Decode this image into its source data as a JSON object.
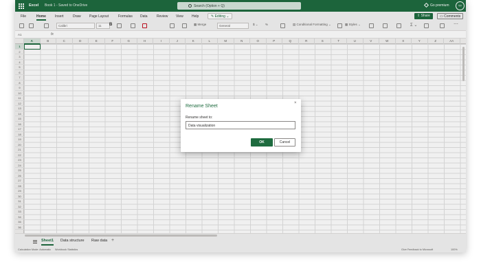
{
  "titlebar": {
    "app_name": "Excel",
    "doc_title": "Book 1 - Saved to OneDrive",
    "search_placeholder": "Search (Option + Q)",
    "premium": "Go premium",
    "avatar": "TT"
  },
  "tabs": [
    "File",
    "Home",
    "Insert",
    "Draw",
    "Page Layout",
    "Formulas",
    "Data",
    "Review",
    "View",
    "Help"
  ],
  "active_tab": "Home",
  "editing_label": "Editing",
  "share_label": "Share",
  "comments_label": "Comments",
  "ribbon": {
    "font_name": "Calibri",
    "font_size": "11",
    "bold": "B",
    "merge": "Merge",
    "number_format": "General",
    "conditional_formatting": "Conditional Formatting",
    "styles": "Styles"
  },
  "formula": {
    "name_box": "A1",
    "fx": "fx"
  },
  "columns": [
    "A",
    "B",
    "C",
    "D",
    "E",
    "F",
    "G",
    "H",
    "I",
    "J",
    "K",
    "L",
    "M",
    "N",
    "O",
    "P",
    "Q",
    "R",
    "S",
    "T",
    "U",
    "V",
    "W",
    "X",
    "Y",
    "Z",
    "AA"
  ],
  "rows": [
    "1",
    "2",
    "3",
    "4",
    "5",
    "6",
    "7",
    "8",
    "9",
    "10",
    "11",
    "12",
    "13",
    "14",
    "15",
    "16",
    "17",
    "18",
    "19",
    "20",
    "21",
    "22",
    "23",
    "24",
    "25",
    "26",
    "27",
    "28",
    "29",
    "30",
    "31",
    "32",
    "33",
    "34",
    "35",
    "36"
  ],
  "sheet_tabs": [
    "Sheet1",
    "Data structure",
    "Raw data"
  ],
  "active_sheet": "Sheet1",
  "add_sheet": "+",
  "status": {
    "calc_mode": "Calculation Mode: Automatic",
    "stats": "Workbook Statistics",
    "feedback": "Give Feedback to Microsoft",
    "zoom": "100%"
  },
  "dialog": {
    "title": "Rename Sheet",
    "close": "×",
    "label": "Rename sheet to:",
    "value": "Data visualization",
    "ok": "OK",
    "cancel": "Cancel"
  },
  "colors": {
    "brand": "#1e6b3f"
  }
}
